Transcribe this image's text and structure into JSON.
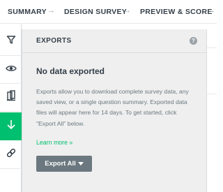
{
  "breadcrumb": {
    "items": [
      "SUMMARY",
      "DESIGN SURVEY",
      "PREVIEW & SCORE"
    ],
    "separator": "→"
  },
  "rail": {
    "items": [
      {
        "icon": "filter-icon"
      },
      {
        "icon": "eye-icon"
      },
      {
        "icon": "compare-icon"
      },
      {
        "icon": "download-icon",
        "active": true
      },
      {
        "icon": "link-icon"
      }
    ]
  },
  "exports": {
    "title": "EXPORTS",
    "help_glyph": "?",
    "empty_title": "No data exported",
    "empty_description": "Exports allow you to download complete survey data, any saved view, or a single question summary. Exported data files will appear here for 14 days. To get started, click \"Export All\" below.",
    "learn_more": "Learn more »",
    "export_button": "Export All"
  },
  "colors": {
    "accent": "#00bf6f",
    "panel_bg": "#efefef",
    "button_bg": "#6b787f",
    "text": "#333e48"
  }
}
